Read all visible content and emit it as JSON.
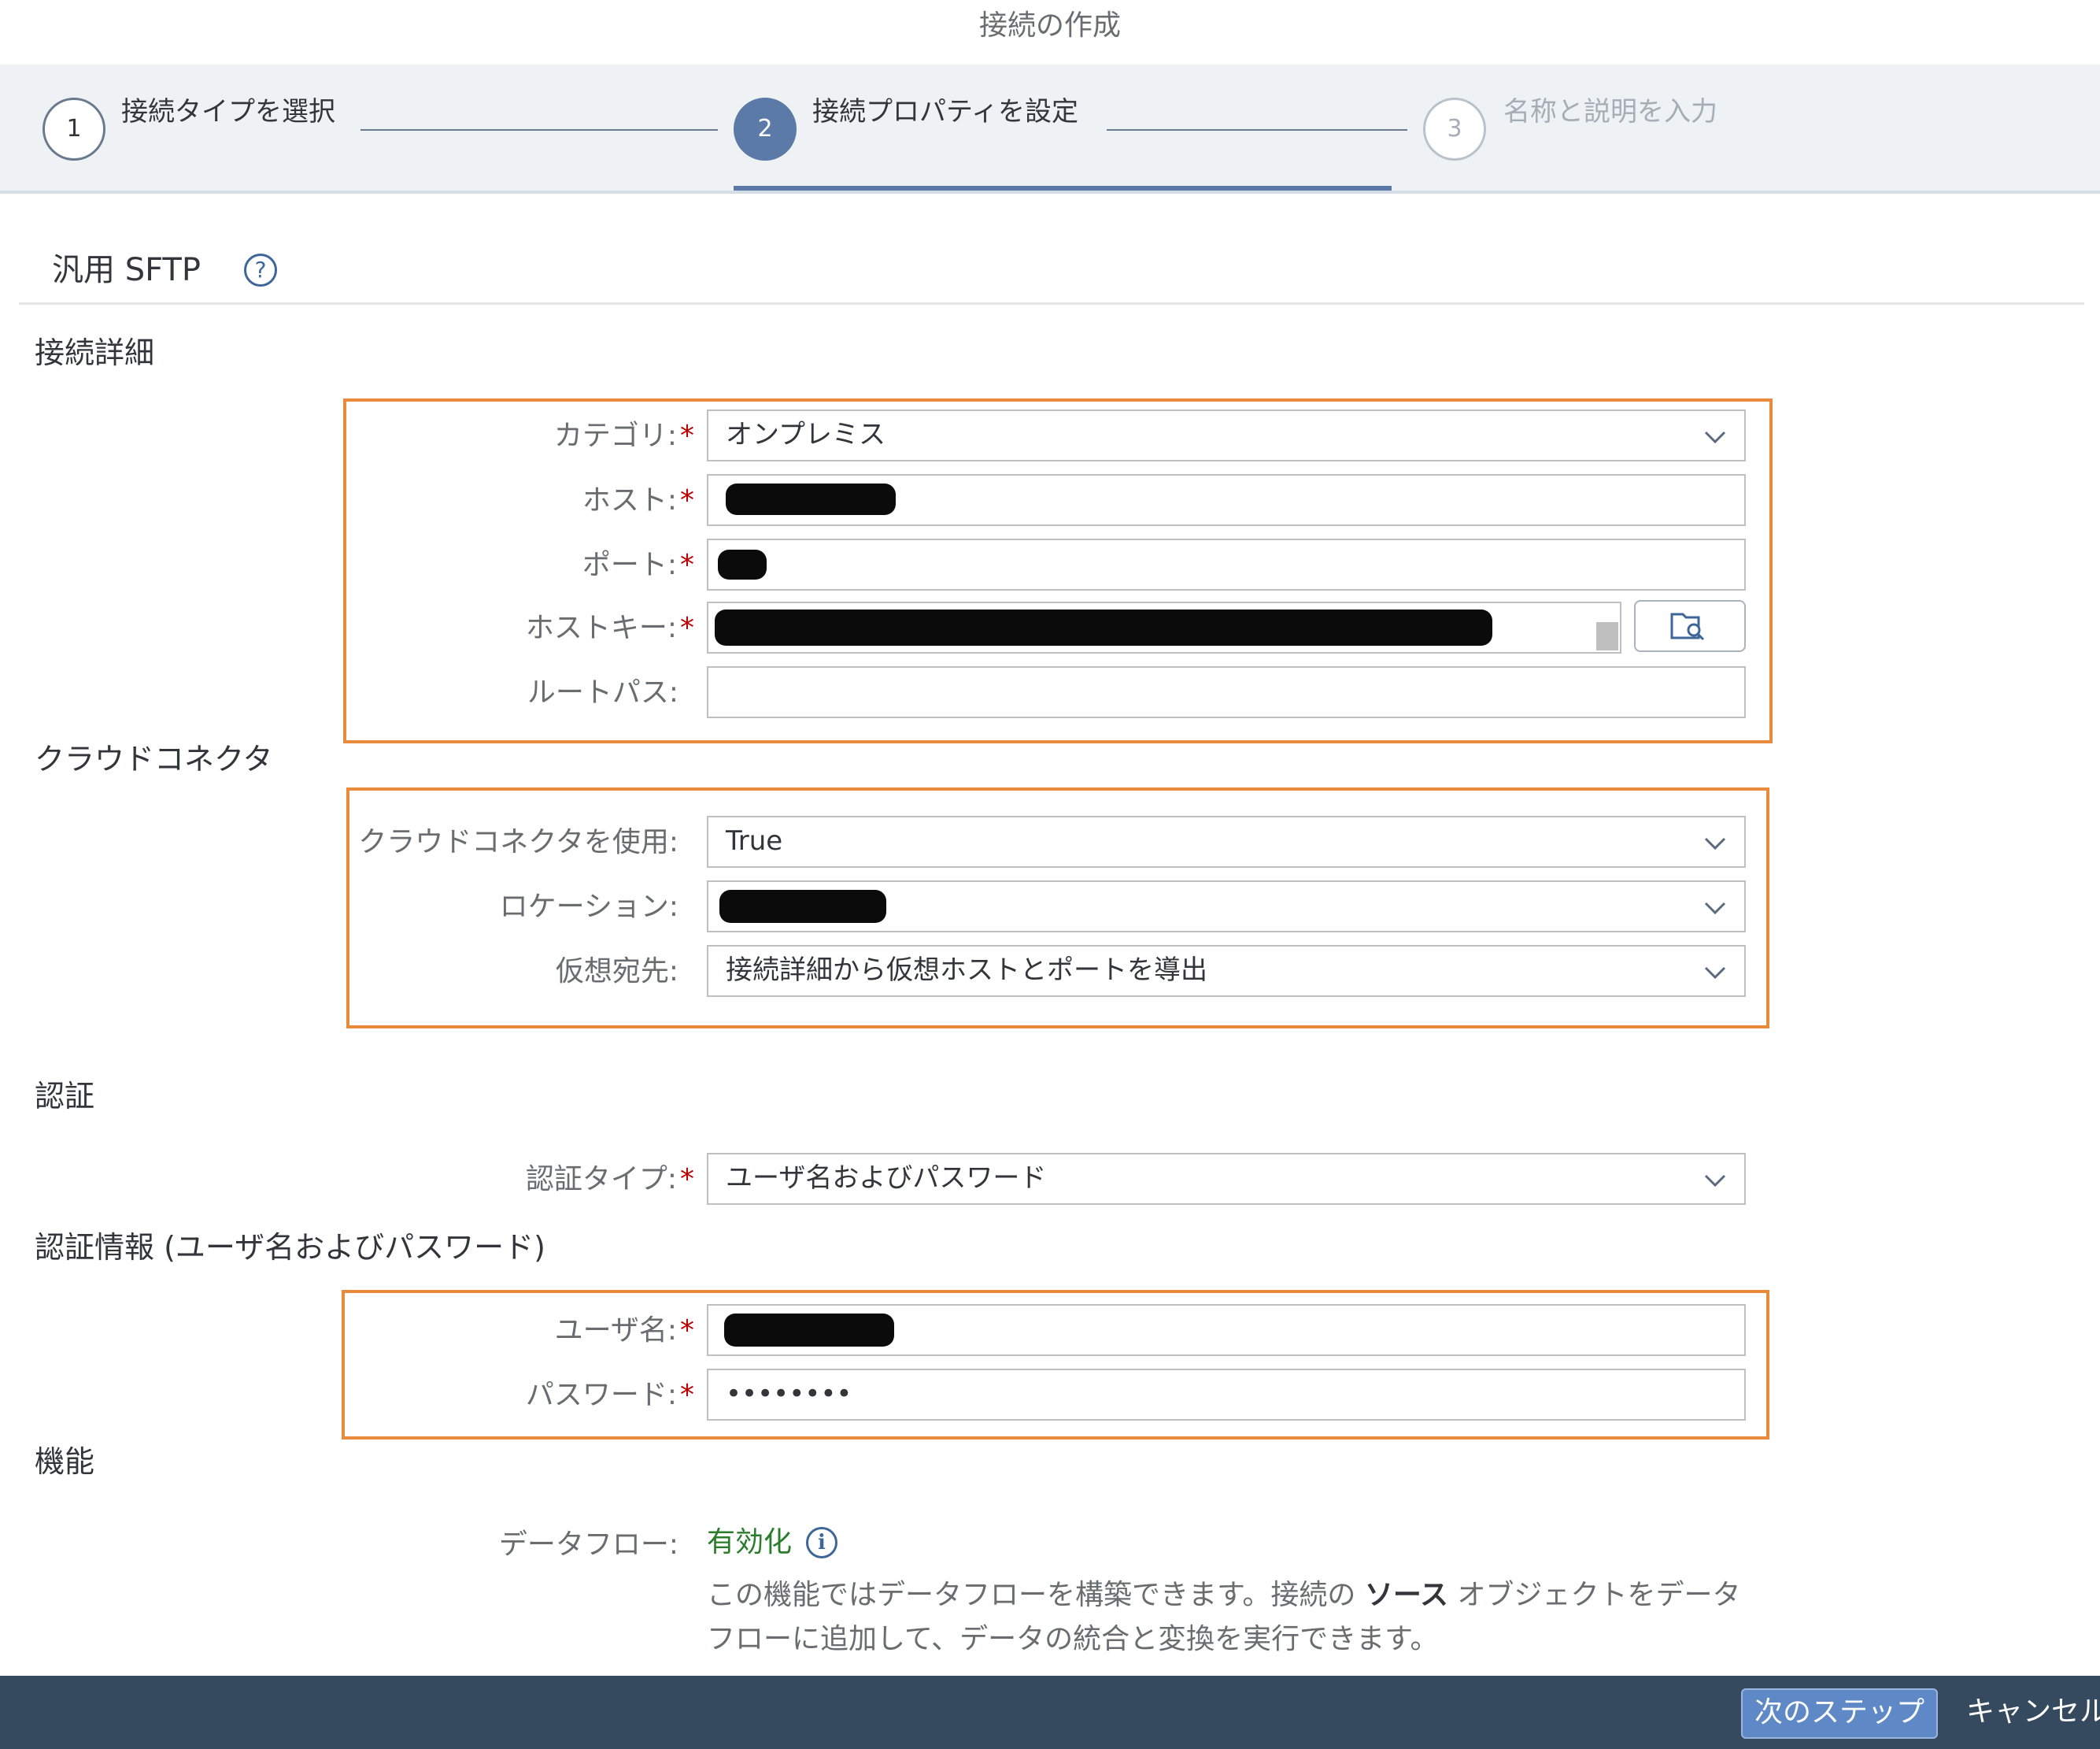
{
  "dialog": {
    "title": "接続の作成"
  },
  "wizard": {
    "steps": [
      {
        "number": "1",
        "label": "接続タイプを選択",
        "state": "completed"
      },
      {
        "number": "2",
        "label": "接続プロパティを設定",
        "state": "active"
      },
      {
        "number": "3",
        "label": "名称と説明を入力",
        "state": "disabled"
      }
    ]
  },
  "connection_type": {
    "title": "汎用 SFTP",
    "help_icon": "question-circle-icon"
  },
  "sections": {
    "connection_details": {
      "title": "接続詳細",
      "fields": {
        "category": {
          "label": "カテゴリ:",
          "value": "オンプレミス"
        },
        "host": {
          "label": "ホスト:",
          "value": ""
        },
        "port": {
          "label": "ポート:",
          "value": ""
        },
        "host_key": {
          "label": "ホストキー:",
          "value": ""
        },
        "root_path": {
          "label": "ルートパス:",
          "value": ""
        }
      }
    },
    "cloud_connector": {
      "title": "クラウドコネクタ",
      "fields": {
        "use_cloud_connector": {
          "label": "クラウドコネクタを使用:",
          "value": "True"
        },
        "location": {
          "label": "ロケーション:",
          "value": ""
        },
        "virtual_destination": {
          "label": "仮想宛先:",
          "value": "接続詳細から仮想ホストとポートを導出"
        }
      }
    },
    "authentication": {
      "title": "認証",
      "fields": {
        "auth_type": {
          "label": "認証タイプ:",
          "value": "ユーザ名およびパスワード"
        }
      }
    },
    "credentials": {
      "title": "認証情報 (ユーザ名およびパスワード)",
      "fields": {
        "username": {
          "label": "ユーザ名:",
          "value": ""
        },
        "password": {
          "label": "パスワード:",
          "value": "••••••••"
        }
      }
    },
    "features": {
      "title": "機能",
      "fields": {
        "data_flow": {
          "label": "データフロー:",
          "status": "有効化",
          "description_line1_pre": "この機能ではデータフローを構築できます。接続の",
          "description_bold": "ソース",
          "description_line1_post": "オブジェクトをデータ",
          "description_line2": "フローに追加して、データの統合と変換を実行できます。"
        }
      }
    }
  },
  "required_marker": "*",
  "footer": {
    "next_label": "次のステップ",
    "cancel_label": "キャンセル"
  },
  "colors": {
    "accent": "#5b7aa8",
    "highlight": "#ea8a3d",
    "enabled_status": "#2b7d2b",
    "footer_bg": "#354a5f",
    "required": "#bb0000"
  }
}
